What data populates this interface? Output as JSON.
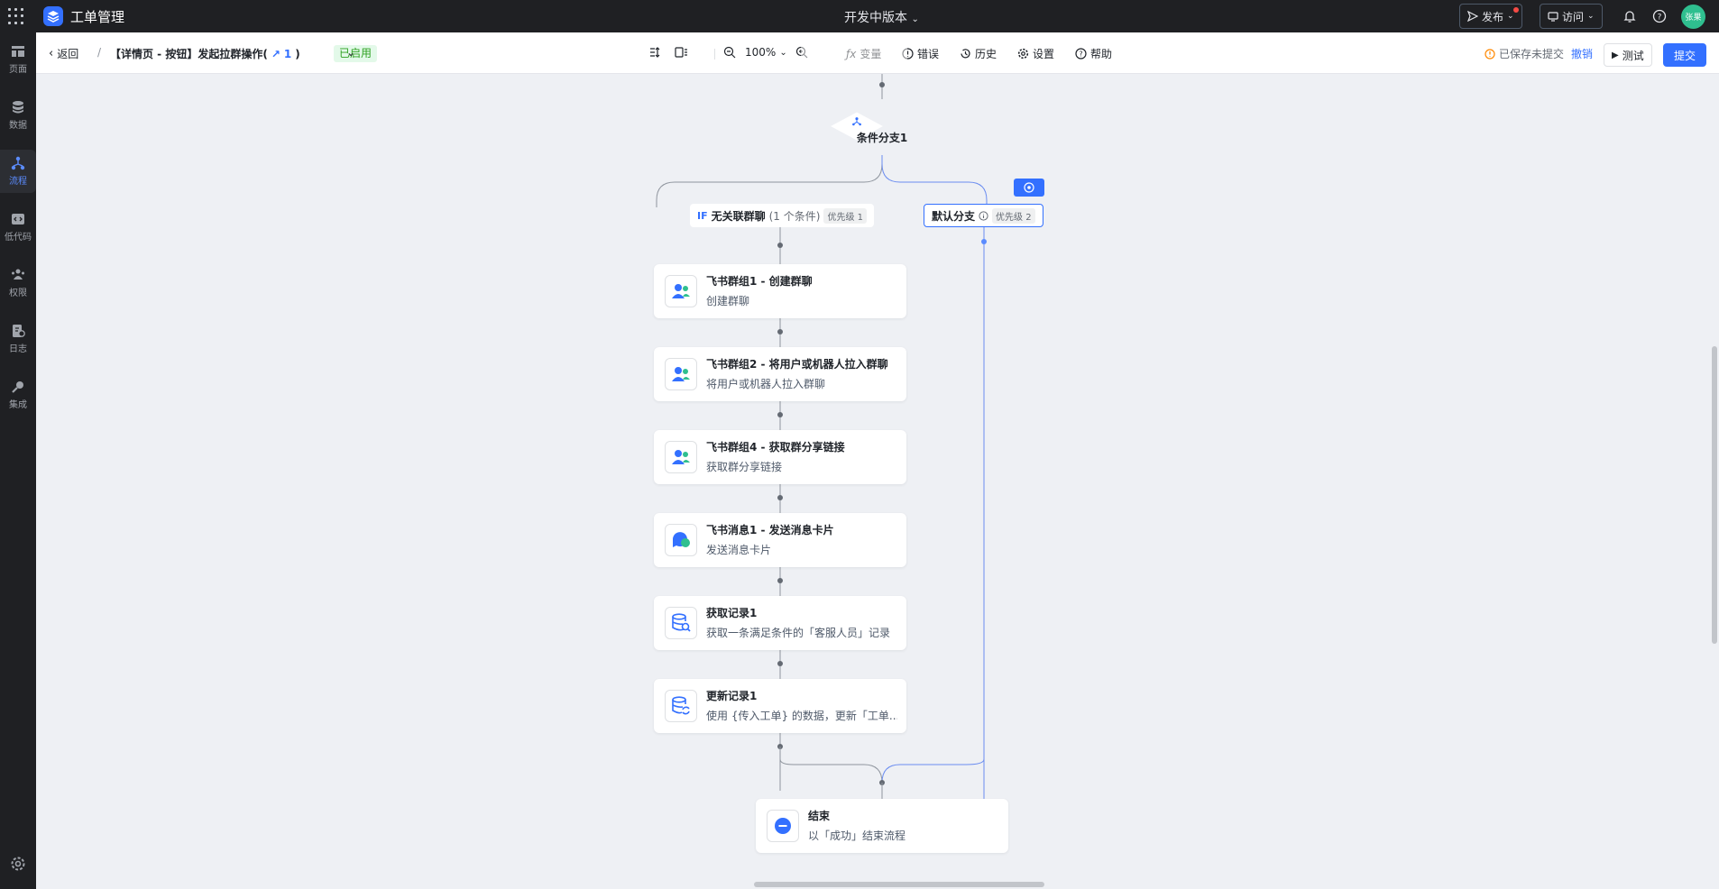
{
  "app": {
    "name": "工单管理",
    "version": "开发中版本"
  },
  "topbar": {
    "publish": "发布",
    "visit": "访问",
    "user_initials": "张果"
  },
  "sidebar": {
    "items": [
      {
        "label": "页面",
        "icon": "pages-icon"
      },
      {
        "label": "数据",
        "icon": "database-icon"
      },
      {
        "label": "流程",
        "icon": "flow-icon",
        "active": true
      },
      {
        "label": "低代码",
        "icon": "code-icon"
      },
      {
        "label": "权限",
        "icon": "permission-icon"
      },
      {
        "label": "日志",
        "icon": "log-icon"
      },
      {
        "label": "集成",
        "icon": "integration-icon"
      }
    ]
  },
  "toolbar": {
    "back": "返回",
    "separator": "/",
    "flow_title": "【详情页 - 按钮】发起拉群操作(",
    "version_num": "1",
    "flow_title_close": ")",
    "status": "已启用",
    "zoom": "100%",
    "variables": "变量",
    "errors": "错误",
    "history": "历史",
    "settings": "设置",
    "help": "帮助",
    "save_status": "已保存未提交",
    "undo": "撤销",
    "test": "测试",
    "submit": "提交"
  },
  "flow": {
    "condition_node": "条件分支1",
    "branches": [
      {
        "tag": "IF",
        "name": "无关联群聊",
        "conditions": "(1 个条件)",
        "priority": "优先级 1"
      },
      {
        "name": "默认分支",
        "priority": "优先级 2"
      }
    ],
    "nodes": [
      {
        "title": "飞书群组1 - 创建群聊",
        "subtitle": "创建群聊",
        "icon": "group-icon"
      },
      {
        "title": "飞书群组2 - 将用户或机器人拉入群聊",
        "subtitle": "将用户或机器人拉入群聊",
        "icon": "group-icon"
      },
      {
        "title": "飞书群组4 - 获取群分享链接",
        "subtitle": "获取群分享链接",
        "icon": "group-icon"
      },
      {
        "title": "飞书消息1 - 发送消息卡片",
        "subtitle": "发送消息卡片",
        "icon": "message-icon"
      },
      {
        "title": "获取记录1",
        "subtitle": "获取一条满足条件的「客服人员」记录",
        "icon": "db-search-icon"
      },
      {
        "title": "更新记录1",
        "subtitle": "使用 {传入工单} 的数据，更新「工单...",
        "icon": "db-update-icon"
      }
    ],
    "end_node": {
      "title": "结束",
      "subtitle": "以「成功」结束流程"
    }
  },
  "colors": {
    "accent": "#3370ff",
    "dark": "#1f2023",
    "canvas": "#eef0f4",
    "success": "#2ea121"
  }
}
